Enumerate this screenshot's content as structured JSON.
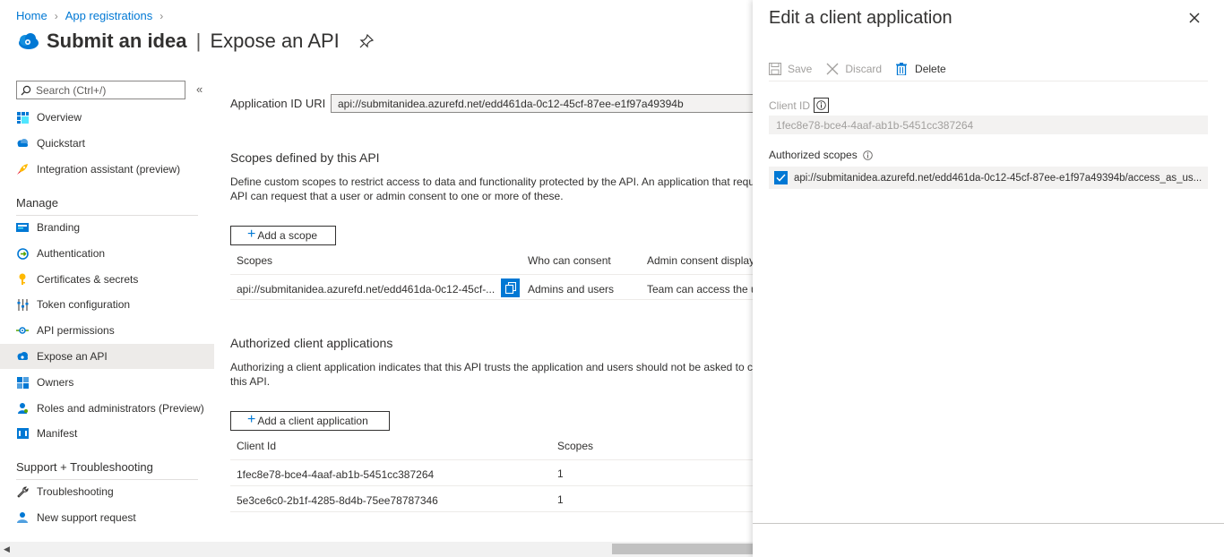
{
  "breadcrumb": {
    "home": "Home",
    "app_registrations": "App registrations"
  },
  "header": {
    "title": "Submit an idea",
    "separator": "|",
    "subtitle": "Expose an API",
    "pin_icon": "pin-icon"
  },
  "sidebar": {
    "search_placeholder": "Search (Ctrl+/)",
    "collapse": "«",
    "top_items": [
      {
        "label": "Overview",
        "icon": "overview-grid-icon"
      },
      {
        "label": "Quickstart",
        "icon": "cloud-icon"
      },
      {
        "label": "Integration assistant (preview)",
        "icon": "rocket-icon"
      }
    ],
    "manage_heading": "Manage",
    "manage_items": [
      {
        "label": "Branding",
        "icon": "branding-icon"
      },
      {
        "label": "Authentication",
        "icon": "authentication-icon"
      },
      {
        "label": "Certificates & secrets",
        "icon": "key-icon"
      },
      {
        "label": "Token configuration",
        "icon": "sliders-icon"
      },
      {
        "label": "API permissions",
        "icon": "api-permissions-icon"
      },
      {
        "label": "Expose an API",
        "icon": "cloud-icon"
      },
      {
        "label": "Owners",
        "icon": "owners-icon"
      },
      {
        "label": "Roles and administrators (Preview)",
        "icon": "roles-icon"
      },
      {
        "label": "Manifest",
        "icon": "manifest-icon"
      }
    ],
    "support_heading": "Support + Troubleshooting",
    "support_items": [
      {
        "label": "Troubleshooting",
        "icon": "wrench-icon"
      },
      {
        "label": "New support request",
        "icon": "person-icon"
      }
    ]
  },
  "main": {
    "uri_label": "Application ID URI",
    "uri_value": "api://submitanidea.azurefd.net/edd461da-0c12-45cf-87ee-e1f97a49394b",
    "scopes_heading": "Scopes defined by this API",
    "scopes_desc_1": "Define custom scopes to restrict access to data and functionality protected by the API. An application that require",
    "scopes_desc_2": "API can request that a user or admin consent to one or more of these.",
    "add_scope_button": "Add a scope",
    "scopes_columns": [
      "Scopes",
      "Who can consent",
      "Admin consent display"
    ],
    "scopes_rows": [
      {
        "scope": "api://submitanidea.azurefd.net/edd461da-0c12-45cf-...",
        "who": "Admins and users",
        "display": "Team can access the us"
      }
    ],
    "clients_heading": "Authorized client applications",
    "clients_desc_1": "Authorizing a client application indicates that this API trusts the application and users should not be asked to con",
    "clients_desc_2": "this API.",
    "add_client_button": "Add a client application",
    "clients_columns": [
      "Client Id",
      "Scopes"
    ],
    "clients_rows": [
      {
        "client_id": "1fec8e78-bce4-4aaf-ab1b-5451cc387264",
        "scopes": "1"
      },
      {
        "client_id": "5e3ce6c0-2b1f-4285-8d4b-75ee78787346",
        "scopes": "1"
      }
    ]
  },
  "panel": {
    "title": "Edit a client application",
    "toolbar": {
      "save": "Save",
      "discard": "Discard",
      "delete": "Delete"
    },
    "client_id_label": "Client ID",
    "client_id_value": "1fec8e78-bce4-4aaf-ab1b-5451cc387264",
    "scopes_label": "Authorized scopes",
    "scope_item": "api://submitanidea.azurefd.net/edd461da-0c12-45cf-87ee-e1f97a49394b/access_as_us...",
    "scope_checked": true
  },
  "colors": {
    "accent": "#0078d4",
    "active_nav": "#edebe9"
  }
}
